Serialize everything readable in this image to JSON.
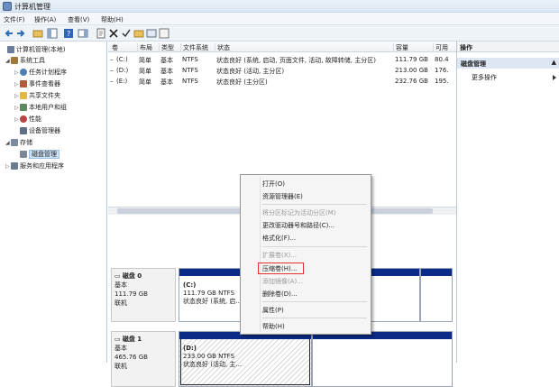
{
  "window": {
    "title": "计算机管理"
  },
  "menu": [
    "文件(F)",
    "操作(A)",
    "查看(V)",
    "帮助(H)"
  ],
  "tree": [
    {
      "label": "计算机管理(本地)",
      "indent": 0,
      "expander": "",
      "icon": "computer-icon",
      "color": "#6b7e99"
    },
    {
      "label": "系统工具",
      "indent": 1,
      "expander": "◢",
      "icon": "tools-icon",
      "color": "#a07a3b"
    },
    {
      "label": "任务计划程序",
      "indent": 2,
      "expander": "▷",
      "icon": "clock-icon",
      "color": "#4f7fb5"
    },
    {
      "label": "事件查看器",
      "indent": 2,
      "expander": "▷",
      "icon": "event-icon",
      "color": "#b05a3a"
    },
    {
      "label": "共享文件夹",
      "indent": 2,
      "expander": "▷",
      "icon": "folder-icon",
      "color": "#e1b84c"
    },
    {
      "label": "本地用户和组",
      "indent": 2,
      "expander": "▷",
      "icon": "users-icon",
      "color": "#5d8a5d"
    },
    {
      "label": "性能",
      "indent": 2,
      "expander": "▷",
      "icon": "performance-icon",
      "color": "#b84444"
    },
    {
      "label": "设备管理器",
      "indent": 2,
      "expander": "",
      "icon": "device-icon",
      "color": "#5f6f86"
    },
    {
      "label": "存储",
      "indent": 1,
      "expander": "◢",
      "icon": "storage-icon",
      "color": "#7c8aa0"
    },
    {
      "label": "磁盘管理",
      "indent": 2,
      "expander": "",
      "icon": "disk-icon",
      "color": "#7d8897",
      "selected": true
    },
    {
      "label": "服务和应用程序",
      "indent": 1,
      "expander": "▷",
      "icon": "services-icon",
      "color": "#6a7b93"
    }
  ],
  "volume_columns": [
    "卷",
    "布局",
    "类型",
    "文件系统",
    "状态",
    "容量",
    "可用"
  ],
  "volumes": [
    {
      "name": "(C:)",
      "layout": "简单",
      "type": "基本",
      "fs": "NTFS",
      "status": "状态良好 (系统, 启动, 页面文件, 活动, 故障转储, 主分区)",
      "capacity": "111.79 GB",
      "free": "80.4"
    },
    {
      "name": "(D:)",
      "layout": "简单",
      "type": "基本",
      "fs": "NTFS",
      "status": "状态良好 (活动, 主分区)",
      "capacity": "213.00 GB",
      "free": "176."
    },
    {
      "name": "(E:)",
      "layout": "简单",
      "type": "基本",
      "fs": "NTFS",
      "status": "状态良好 (主分区)",
      "capacity": "232.76 GB",
      "free": "195."
    }
  ],
  "disks": [
    {
      "name": "磁盘 0",
      "type": "基本",
      "size": "111.79 GB",
      "state": "联机",
      "partition": {
        "name": "(C:)",
        "size_fs": "111.79 GB NTFS",
        "status": "状态良好 (系统, 启..."
      }
    },
    {
      "name": "磁盘 1",
      "type": "基本",
      "size": "465.76 GB",
      "state": "联机",
      "partition": {
        "name": "(D:)",
        "size_fs": "233.00 GB NTFS",
        "status": "状态良好 (活动, 主..."
      }
    }
  ],
  "context_menu": [
    {
      "label": "打开(O)",
      "enabled": true
    },
    {
      "label": "资源管理器(E)",
      "enabled": true
    },
    {
      "sep": true
    },
    {
      "label": "将分区标记为活动分区(M)",
      "enabled": false
    },
    {
      "label": "更改驱动器号和路径(C)...",
      "enabled": true
    },
    {
      "label": "格式化(F)...",
      "enabled": true
    },
    {
      "sep": true
    },
    {
      "label": "扩展卷(X)...",
      "enabled": false
    },
    {
      "label": "压缩卷(H)...",
      "enabled": true,
      "highlighted": true
    },
    {
      "label": "添加镜像(A)...",
      "enabled": false
    },
    {
      "label": "删除卷(D)...",
      "enabled": true
    },
    {
      "sep": true
    },
    {
      "label": "属性(P)",
      "enabled": true
    },
    {
      "sep": true
    },
    {
      "label": "帮助(H)",
      "enabled": true
    }
  ],
  "actions_panel": {
    "header": "操作",
    "section": "磁盘管理",
    "more": "更多操作"
  },
  "colors": {
    "partition_bar": "#0b2b87",
    "highlight_box": "#e03232",
    "selection": "#cfe3f8"
  }
}
